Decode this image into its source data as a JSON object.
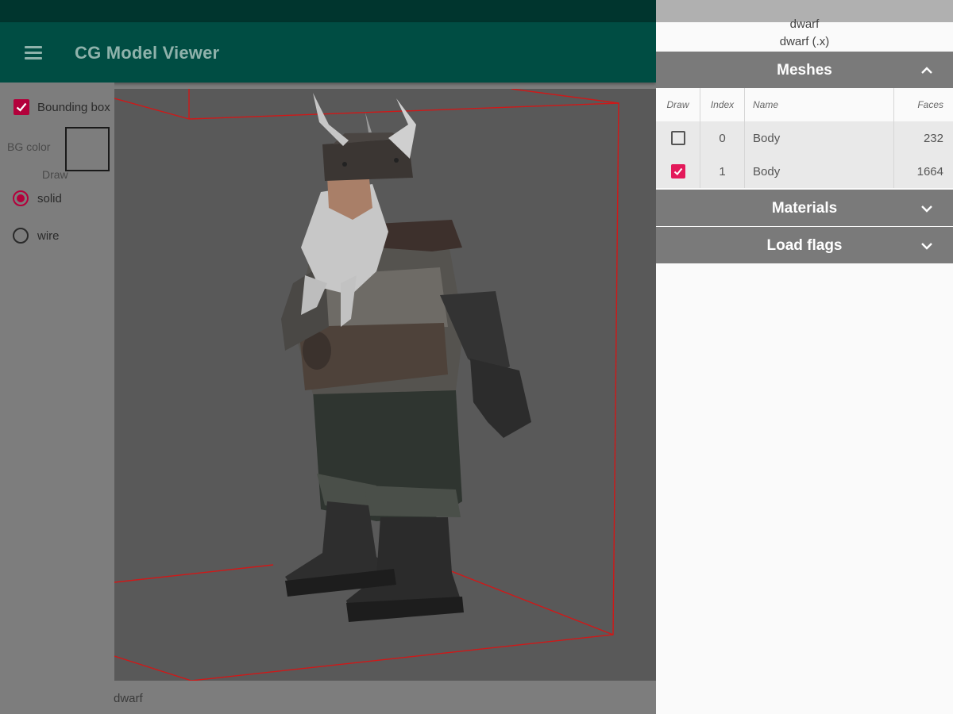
{
  "app": {
    "title": "CG Model Viewer"
  },
  "left_panel": {
    "bounding_box_label": "Bounding box",
    "bounding_box_checked": true,
    "bg_color_label": "BG color",
    "bg_color_value": "#7d7d7d",
    "draw_label": "Draw",
    "draw_options": [
      {
        "label": "solid",
        "selected": true
      },
      {
        "label": "wire",
        "selected": false
      }
    ]
  },
  "viewport": {
    "model_name": "dwarf",
    "bounding_box_color": "#d01818"
  },
  "right_panel": {
    "file_name": "dwarf",
    "file_type": "dwarf (.x)",
    "meshes": {
      "title": "Meshes",
      "expanded": true,
      "columns": {
        "draw": "Draw",
        "index": "Index",
        "name": "Name",
        "faces": "Faces"
      },
      "rows": [
        {
          "draw": false,
          "index": "0",
          "name": "Body",
          "faces": "232"
        },
        {
          "draw": true,
          "index": "1",
          "name": "Body",
          "faces": "1664"
        }
      ]
    },
    "materials": {
      "title": "Materials",
      "expanded": false
    },
    "load_flags": {
      "title": "Load flags",
      "expanded": false
    }
  },
  "colors": {
    "appbar": "#004d43",
    "statusbar": "#00352e",
    "accent": "#e3195a",
    "section_header": "#7a7a7a"
  }
}
